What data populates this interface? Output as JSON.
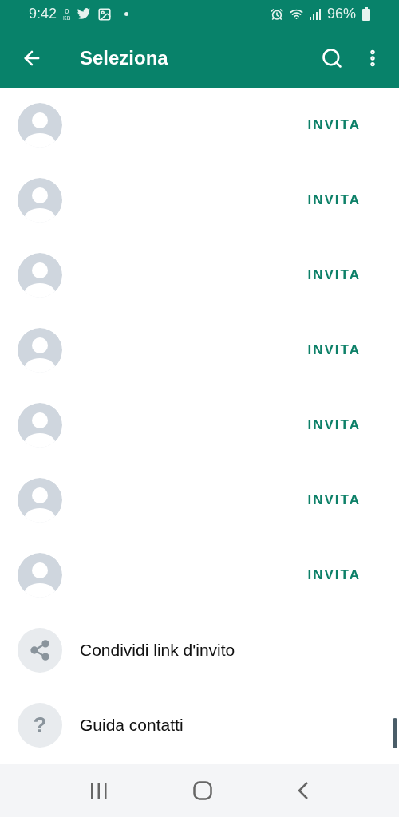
{
  "status_bar": {
    "time": "9:42",
    "net_speed_value": "0",
    "net_speed_unit": "KB",
    "battery": "96%"
  },
  "app_bar": {
    "title": "Seleziona"
  },
  "contacts": [
    {
      "action": "INVITA"
    },
    {
      "action": "INVITA"
    },
    {
      "action": "INVITA"
    },
    {
      "action": "INVITA"
    },
    {
      "action": "INVITA"
    },
    {
      "action": "INVITA"
    },
    {
      "action": "INVITA"
    }
  ],
  "actions": [
    {
      "kind": "share",
      "label": "Condividi link d'invito"
    },
    {
      "kind": "help",
      "glyph": "?",
      "label": "Guida contatti"
    }
  ]
}
